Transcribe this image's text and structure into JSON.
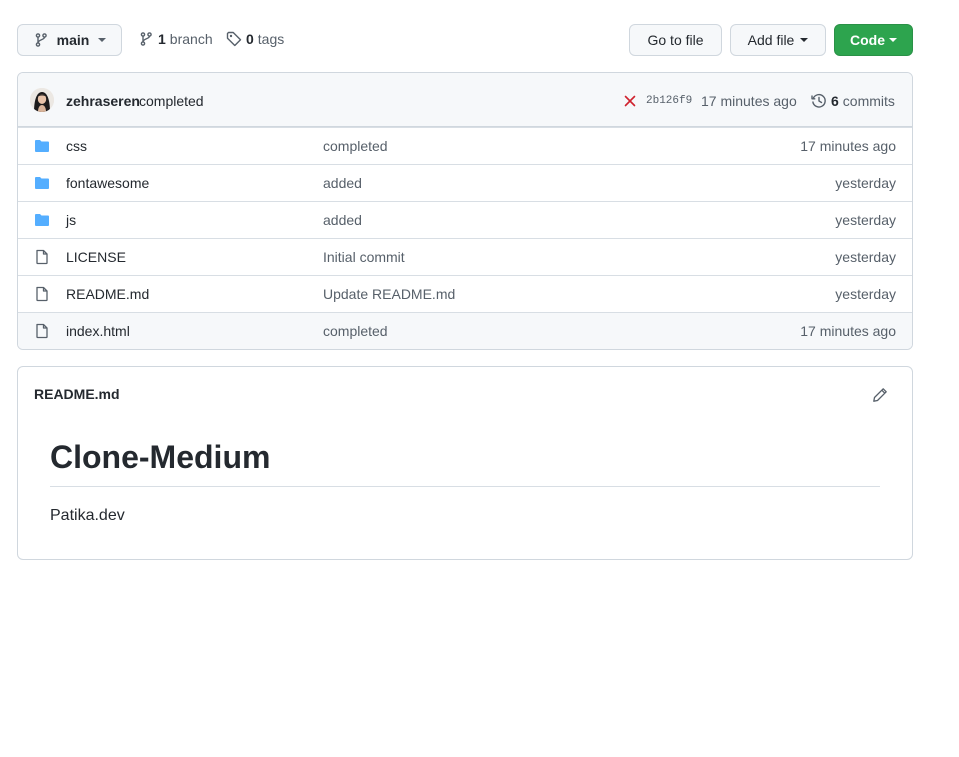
{
  "toolbar": {
    "branch_selector": "main",
    "branch_count": "1",
    "branch_label": "branch",
    "tag_count": "0",
    "tag_label": "tags",
    "go_to_file": "Go to file",
    "add_file": "Add file",
    "code": "Code"
  },
  "commit": {
    "author": "zehraseren",
    "message": "completed",
    "sha": "2b126f9",
    "time": "17 minutes ago",
    "commit_count": "6",
    "commit_label": "commits",
    "status": "failed"
  },
  "files": [
    {
      "name": "css",
      "type": "folder",
      "message": "completed",
      "age": "17 minutes ago"
    },
    {
      "name": "fontawesome",
      "type": "folder",
      "message": "added",
      "age": "yesterday"
    },
    {
      "name": "js",
      "type": "folder",
      "message": "added",
      "age": "yesterday"
    },
    {
      "name": "LICENSE",
      "type": "file",
      "message": "Initial commit",
      "age": "yesterday"
    },
    {
      "name": "README.md",
      "type": "file",
      "message": "Update README.md",
      "age": "yesterday"
    },
    {
      "name": "index.html",
      "type": "file",
      "message": "completed",
      "age": "17 minutes ago"
    }
  ],
  "readme": {
    "filename": "README.md",
    "heading": "Clone-Medium",
    "body": "Patika.dev"
  },
  "colors": {
    "folder": "#54aeff",
    "primary": "#2da44e",
    "fail": "#cf222e"
  }
}
